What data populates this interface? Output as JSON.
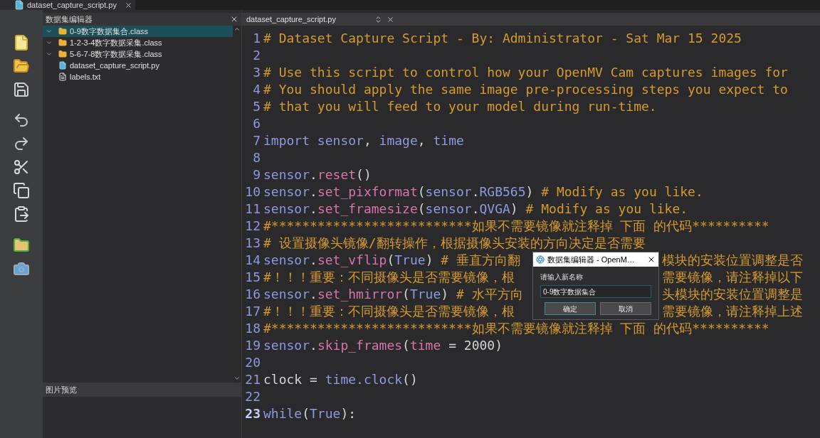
{
  "top_tab": {
    "title": "dataset_capture_script.py"
  },
  "dataset_panel": {
    "title": "数据集编辑器",
    "items": [
      {
        "kind": "folder",
        "label": "0-9数字数据集合.class",
        "selected": true
      },
      {
        "kind": "folder",
        "label": "1-2-3-4数字数据采集.class",
        "selected": false
      },
      {
        "kind": "folder",
        "label": "5-6-7-8数字数据采集.class",
        "selected": false
      },
      {
        "kind": "script",
        "label": "dataset_capture_script.py",
        "selected": false
      },
      {
        "kind": "text",
        "label": "labels.txt",
        "selected": false
      }
    ]
  },
  "preview_panel": {
    "title": "图片预览"
  },
  "editor": {
    "tab": "dataset_capture_script.py",
    "lines": [
      {
        "n": "1",
        "current": false,
        "tokens": [
          {
            "kind": "comment",
            "text": "# Dataset Capture Script - By: Administrator - Sat Mar 15 2025"
          }
        ]
      },
      {
        "n": "2",
        "current": false
      },
      {
        "n": "3",
        "current": false,
        "tokens": [
          {
            "kind": "comment",
            "text": "# Use this script to control how your OpenMV Cam captures images for"
          }
        ]
      },
      {
        "n": "4",
        "current": false,
        "tokens": [
          {
            "kind": "comment",
            "text": "# You should apply the same image pre-processing steps you expect to"
          }
        ]
      },
      {
        "n": "5",
        "current": false,
        "tokens": [
          {
            "kind": "comment",
            "text": "# that you will feed to your model during run-time."
          }
        ]
      },
      {
        "n": "6",
        "current": false
      },
      {
        "n": "7",
        "current": false,
        "tokens": [
          {
            "kind": "keyword",
            "text": "import"
          },
          {
            "kind": "name",
            "text": " sensor"
          },
          {
            "kind": "plain",
            "text": ", "
          },
          {
            "kind": "name",
            "text": "image"
          },
          {
            "kind": "plain",
            "text": ", "
          },
          {
            "kind": "name",
            "text": "time"
          }
        ]
      },
      {
        "n": "8",
        "current": false
      },
      {
        "n": "9",
        "current": false,
        "tokens": [
          {
            "kind": "name",
            "text": "sensor"
          },
          {
            "kind": "plain",
            "text": "."
          },
          {
            "kind": "function",
            "text": "reset"
          },
          {
            "kind": "plain",
            "text": "()"
          }
        ]
      },
      {
        "n": "10",
        "current": false,
        "tokens": [
          {
            "kind": "name",
            "text": "sensor"
          },
          {
            "kind": "plain",
            "text": "."
          },
          {
            "kind": "function",
            "text": "set_pixformat"
          },
          {
            "kind": "plain",
            "text": "("
          },
          {
            "kind": "name",
            "text": "sensor"
          },
          {
            "kind": "plain",
            "text": "."
          },
          {
            "kind": "name",
            "text": "RGB565"
          },
          {
            "kind": "plain",
            "text": ") "
          },
          {
            "kind": "comment",
            "text": "# Modify as you like."
          }
        ]
      },
      {
        "n": "11",
        "current": false,
        "tokens": [
          {
            "kind": "name",
            "text": "sensor"
          },
          {
            "kind": "plain",
            "text": "."
          },
          {
            "kind": "function",
            "text": "set_framesize"
          },
          {
            "kind": "plain",
            "text": "("
          },
          {
            "kind": "name",
            "text": "sensor"
          },
          {
            "kind": "plain",
            "text": "."
          },
          {
            "kind": "name",
            "text": "QVGA"
          },
          {
            "kind": "plain",
            "text": ") "
          },
          {
            "kind": "comment",
            "text": "# Modify as you like."
          }
        ]
      },
      {
        "n": "12",
        "current": false,
        "tokens": [
          {
            "kind": "comment",
            "text": "#**************************如果不需要镜像就注释掉 下面 的代码**********"
          }
        ]
      },
      {
        "n": "13",
        "current": false,
        "tokens": [
          {
            "kind": "comment",
            "text": "# 设置摄像头镜像/翻转操作，根据摄像头安装的方向决定是否需要"
          }
        ]
      },
      {
        "n": "14",
        "current": false,
        "tokens": [
          {
            "kind": "name",
            "text": "sensor"
          },
          {
            "kind": "plain",
            "text": "."
          },
          {
            "kind": "function",
            "text": "set_vflip"
          },
          {
            "kind": "plain",
            "text": "("
          },
          {
            "kind": "keyword",
            "text": "True"
          },
          {
            "kind": "plain",
            "text": ")  "
          },
          {
            "kind": "comment",
            "text": "# 垂直方向翻"
          }
        ],
        "tokens_after_dialog": [
          {
            "kind": "comment",
            "text": "模块的安装位置调整是否"
          }
        ]
      },
      {
        "n": "15",
        "current": false,
        "tokens": [
          {
            "kind": "comment",
            "text": "#！！！重要：不同摄像头是否需要镜像，根"
          }
        ],
        "tokens_after_dialog": [
          {
            "kind": "comment",
            "text": "需要镜像，请注释掉以下"
          }
        ]
      },
      {
        "n": "16",
        "current": false,
        "tokens": [
          {
            "kind": "name",
            "text": "sensor"
          },
          {
            "kind": "plain",
            "text": "."
          },
          {
            "kind": "function",
            "text": "set_hmirror"
          },
          {
            "kind": "plain",
            "text": "("
          },
          {
            "kind": "keyword",
            "text": "True"
          },
          {
            "kind": "plain",
            "text": ")  "
          },
          {
            "kind": "comment",
            "text": "# 水平方向"
          }
        ],
        "tokens_after_dialog": [
          {
            "kind": "comment",
            "text": "头模块的安装位置调整是"
          }
        ]
      },
      {
        "n": "17",
        "current": false,
        "tokens": [
          {
            "kind": "comment",
            "text": "#！！！重要：不同摄像头是否需要镜像，根"
          }
        ],
        "tokens_after_dialog": [
          {
            "kind": "comment",
            "text": "需要镜像，请注释掉上述"
          }
        ]
      },
      {
        "n": "18",
        "current": false,
        "tokens": [
          {
            "kind": "comment",
            "text": "#**************************如果不需要镜像就注释掉 下面 的代码**********"
          }
        ]
      },
      {
        "n": "19",
        "current": false,
        "tokens": [
          {
            "kind": "name",
            "text": "sensor"
          },
          {
            "kind": "plain",
            "text": "."
          },
          {
            "kind": "function",
            "text": "skip_frames"
          },
          {
            "kind": "plain",
            "text": "("
          },
          {
            "kind": "function",
            "text": "time"
          },
          {
            "kind": "plain",
            "text": " = 2000)"
          }
        ]
      },
      {
        "n": "20",
        "current": false
      },
      {
        "n": "21",
        "current": false,
        "tokens": [
          {
            "kind": "plain",
            "text": "clock = "
          },
          {
            "kind": "name",
            "text": "time.clock"
          },
          {
            "kind": "plain",
            "text": "()"
          }
        ]
      },
      {
        "n": "22",
        "current": false
      },
      {
        "n": "23",
        "current": true,
        "tokens": [
          {
            "kind": "keyword",
            "text": "while"
          },
          {
            "kind": "plain",
            "text": "("
          },
          {
            "kind": "keyword",
            "text": "True"
          },
          {
            "kind": "plain",
            "text": "):"
          }
        ]
      }
    ]
  },
  "dialog": {
    "title": "数据集编辑器 - OpenM…",
    "prompt": "请输入新名称",
    "value": "0-9数字数据集合",
    "buttons": [
      {
        "label": "确定",
        "default": true
      },
      {
        "label": "取消",
        "default": false
      }
    ]
  }
}
